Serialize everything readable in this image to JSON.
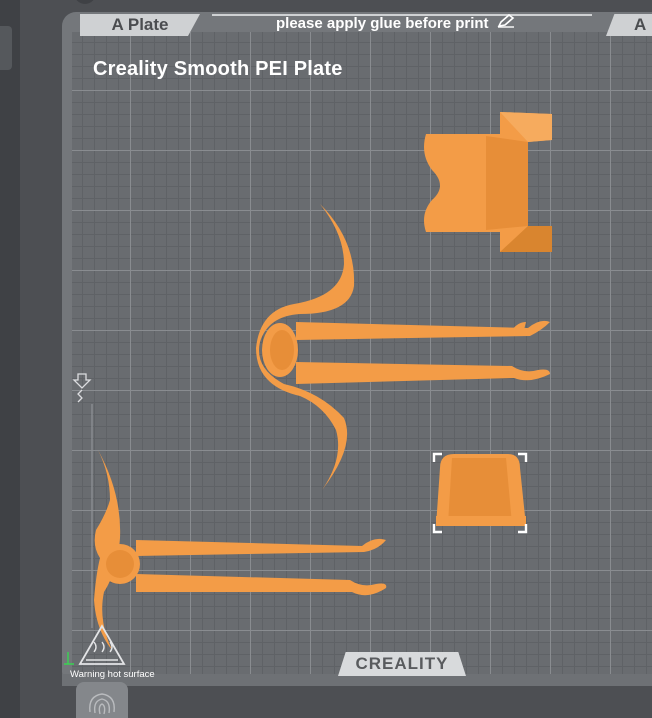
{
  "plate": {
    "active_tab": "A Plate",
    "next_tab": "A",
    "glue_notice": "please apply glue before print",
    "plate_type": "Creality Smooth PEI Plate"
  },
  "bed": {
    "brand": "CREALITY",
    "warning": "Warning hot surface"
  },
  "colors": {
    "model": "#f39c47",
    "model_shadow": "#d9852f",
    "selection": "#ffffff",
    "grid_major": "#898c90",
    "bed": "#696c70"
  },
  "icons": [
    "pencil-icon",
    "hot-surface-warning-icon",
    "fingerprint-icon",
    "arrow-indicator-icon"
  ]
}
